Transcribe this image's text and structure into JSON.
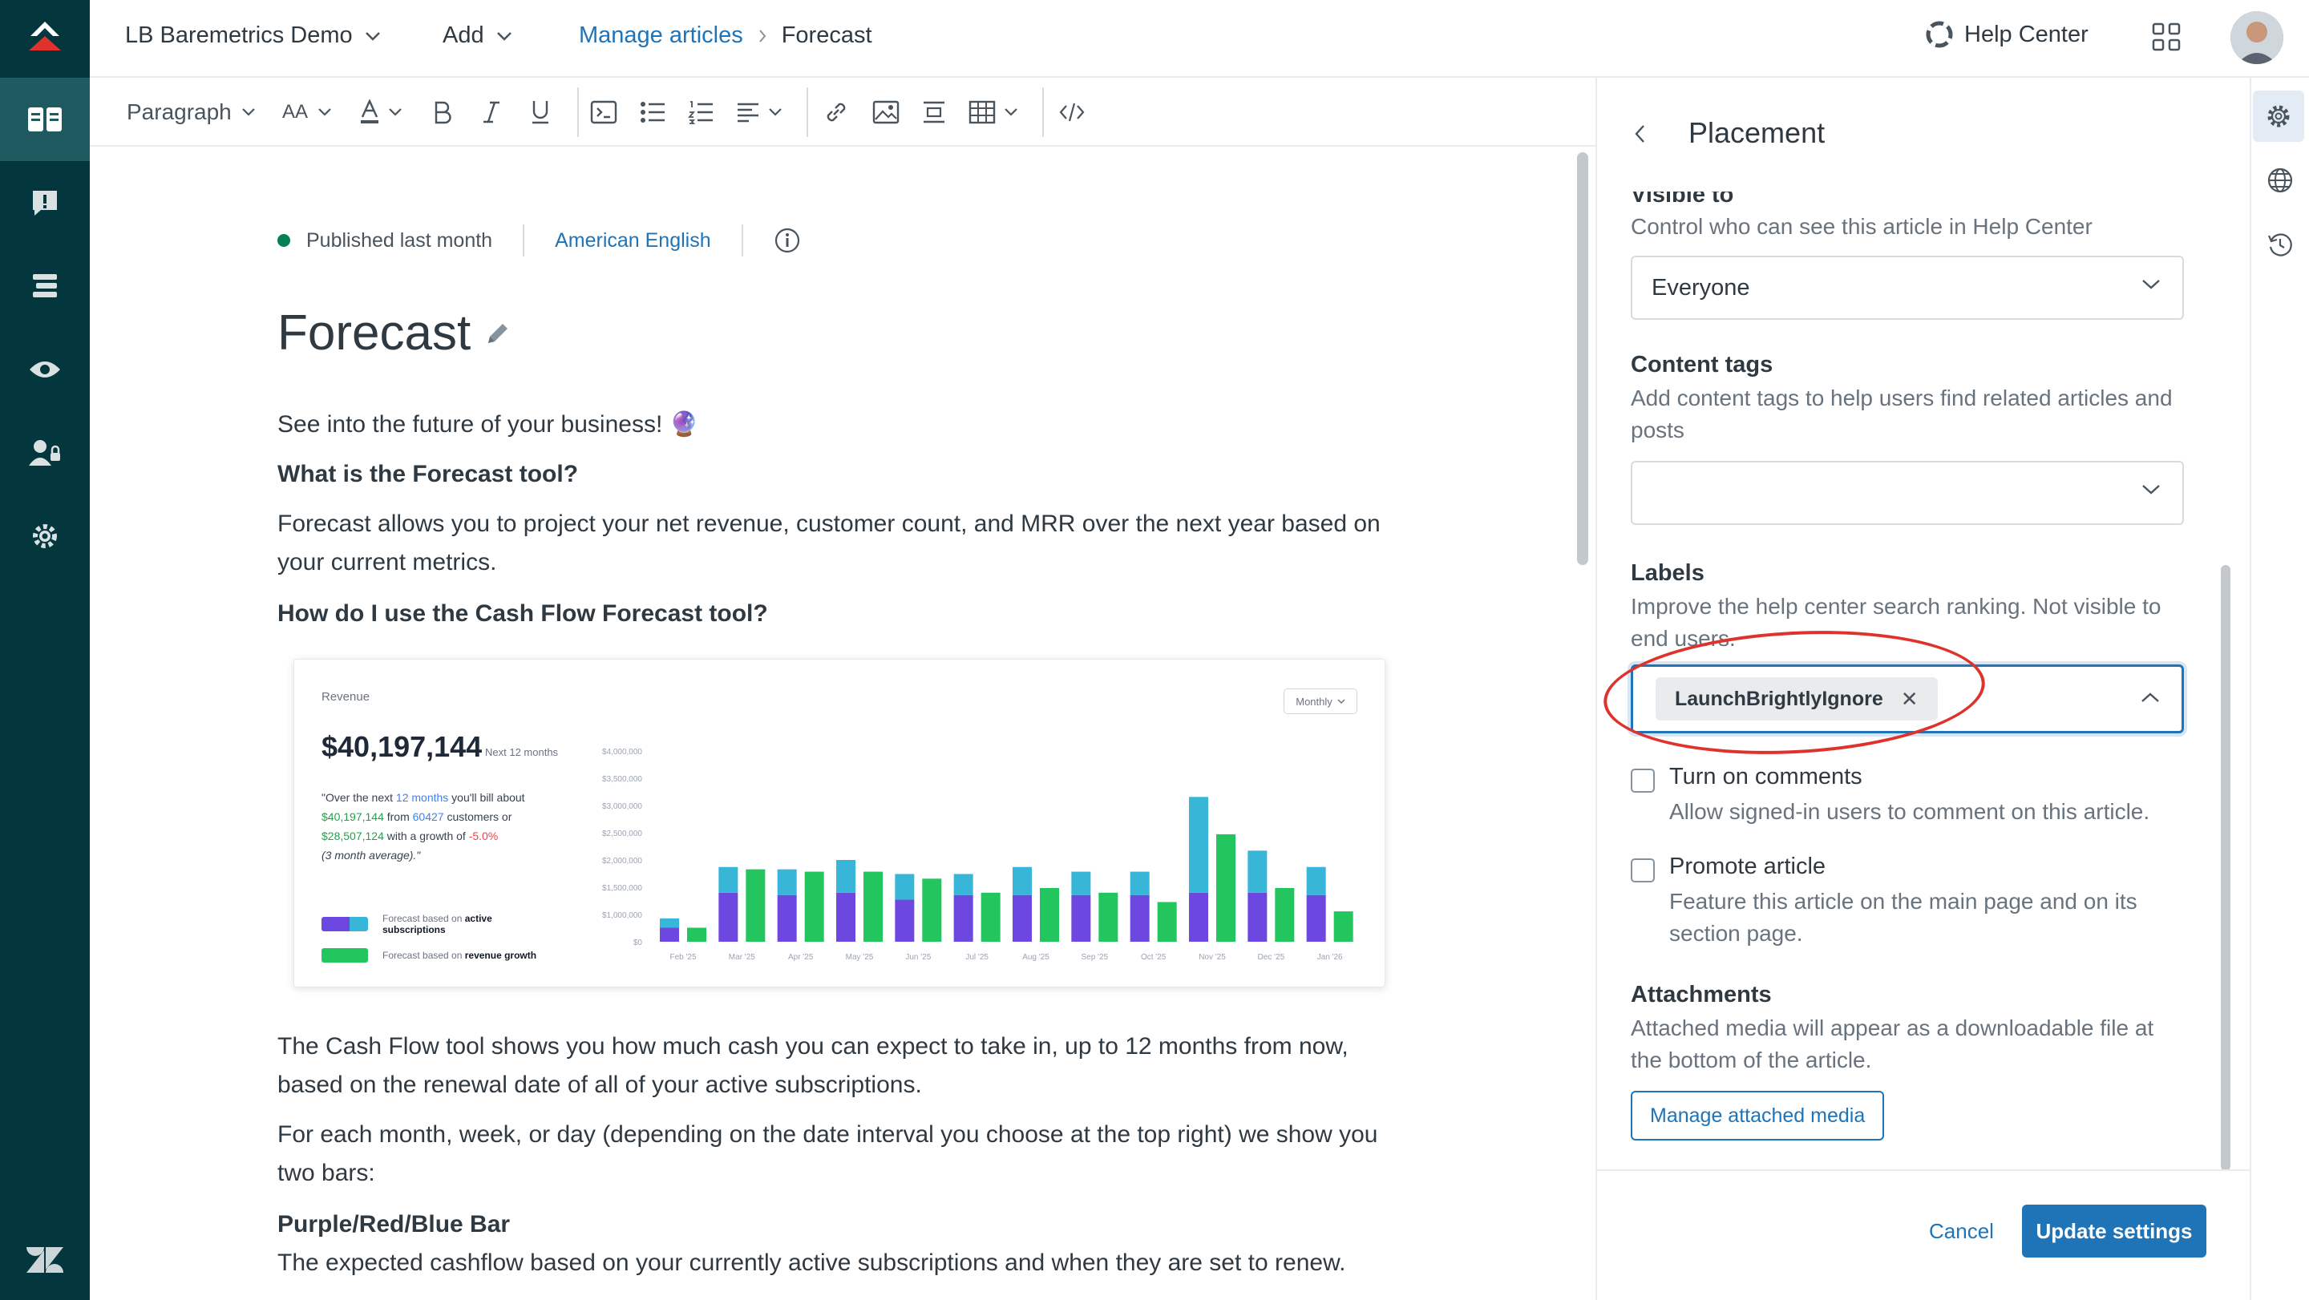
{
  "header": {
    "brand": "LB Baremetrics Demo",
    "add_label": "Add",
    "breadcrumb_link": "Manage articles",
    "breadcrumb_current": "Forecast",
    "help_center": "Help Center"
  },
  "toolbar": {
    "paragraph": "Paragraph",
    "font_size": "AA"
  },
  "article": {
    "status": "Published last month",
    "language": "American English",
    "title": "Forecast",
    "intro": "See into the future of your business! 🔮",
    "h1": "What is the Forecast tool?",
    "p1": "Forecast allows you to project your net revenue, customer count, and MRR over the next year based on your current metrics.",
    "h2": "How do I use the Cash Flow Forecast tool?",
    "p2": "The Cash Flow tool shows you how much cash you can expect to take in, up to 12 months from now, based on the renewal date of all of your active subscriptions.",
    "p3": "For each month, week, or day (depending on the date interval you choose at the top right) we show you two bars:",
    "h3": "Purple/Red/Blue Bar",
    "p4": "The expected cashflow based on your currently active subscriptions and when they are set to renew."
  },
  "figure": {
    "label": "Revenue",
    "total": "$40,197,144",
    "next": "Next 12 months",
    "desc_a": "\"Over the next ",
    "desc_b": "12 months",
    "desc_c": " you'll bill about ",
    "desc_d": "$40,197,144",
    "desc_e": " from ",
    "desc_f": "60427",
    "desc_g": " customers or ",
    "desc_h": "$28,507,124",
    "desc_i": " with a growth of ",
    "desc_j": "-5.0%",
    "desc_k": "(3 month average).\"",
    "legend1_a": "Forecast based on ",
    "legend1_b": "active",
    "legend1_c": "subscriptions",
    "legend2_a": "Forecast based on ",
    "legend2_b": "revenue growth",
    "interval": "Monthly",
    "colors": {
      "purple": "#6c47e0",
      "blue": "#38b6d8",
      "green": "#22c55e"
    }
  },
  "chart_data": {
    "type": "bar",
    "categories": [
      "Feb '25",
      "Mar '25",
      "Apr '25",
      "May '25",
      "Jun '25",
      "Jul '25",
      "Aug '25",
      "Sep '25",
      "Oct '25",
      "Nov '25",
      "Dec '25",
      "Jan '26"
    ],
    "y_ticks": [
      "$4,000,000",
      "$3,500,000",
      "$3,000,000",
      "$2,500,000",
      "$2,000,000",
      "$1,500,000",
      "$1,000,000",
      "$0"
    ],
    "ylim": [
      0,
      3500000
    ],
    "series": [
      {
        "name": "active subscriptions",
        "values": [
          300000,
          1050000,
          1000000,
          1050000,
          900000,
          1000000,
          1000000,
          1000000,
          1000000,
          1050000,
          1050000,
          1000000
        ]
      },
      {
        "name": "",
        "values": [
          200000,
          550000,
          550000,
          700000,
          550000,
          450000,
          600000,
          500000,
          500000,
          2050000,
          900000,
          600000
        ]
      },
      {
        "name": "revenue growth",
        "values": [
          300000,
          1550000,
          1500000,
          1500000,
          1350000,
          1050000,
          1150000,
          1050000,
          850000,
          2300000,
          1150000,
          650000
        ]
      }
    ]
  },
  "panel": {
    "title": "Placement",
    "visible_to_label": "Visible to",
    "visible_to_hint": "Control who can see this article in Help Center",
    "visible_to_value": "Everyone",
    "content_tags_label": "Content tags",
    "content_tags_hint": "Add content tags to help users find related articles and posts",
    "labels_label": "Labels",
    "labels_hint": "Improve the help center search ranking. Not visible to end users.",
    "label_tag": "LaunchBrightlyIgnore",
    "comments_title": "Turn on comments",
    "comments_hint": "Allow signed-in users to comment on this article.",
    "promote_title": "Promote article",
    "promote_hint": "Feature this article on the main page and on its section page.",
    "attachments_label": "Attachments",
    "attachments_hint": "Attached media will appear as a downloadable file at the bottom of the article.",
    "manage_media": "Manage attached media",
    "cancel": "Cancel",
    "update": "Update settings"
  },
  "icons": {
    "rail": [
      "knowledge-icon",
      "feedback-icon",
      "arrange-icon",
      "preview-icon",
      "team-icon",
      "settings-icon"
    ],
    "right_rail": [
      "gear-icon",
      "globe-icon",
      "history-icon"
    ]
  }
}
